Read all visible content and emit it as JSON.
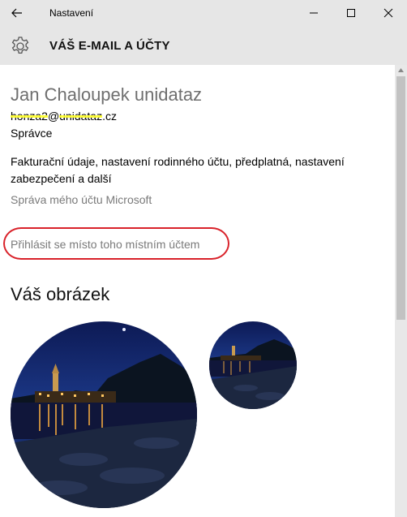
{
  "titlebar": {
    "title": "Nastavení",
    "back_icon": "back-arrow-icon",
    "minimize_icon": "minimize-icon",
    "maximize_icon": "maximize-icon",
    "close_icon": "close-icon"
  },
  "header": {
    "icon": "gear-icon",
    "title": "VÁŠ E-MAIL A ÚČTY"
  },
  "account": {
    "name": "Jan Chaloupek unidataz",
    "email_prefix": "honza2",
    "email_at": "@",
    "email_domain_hl": "unidataz",
    "email_tld": ".cz",
    "role": "Správce",
    "description": "Fakturační údaje, nastavení rodinného účtu, předplatná, nastavení zabezpečení a další",
    "manage_link": "Správa mého účtu Microsoft",
    "local_link": "Přihlásit se místo toho místním účtem"
  },
  "picture": {
    "section_title": "Váš obrázek"
  },
  "colors": {
    "chrome": "#e6e6e6",
    "annotation_red": "#d9222a",
    "highlight_yellow": "#ffff33"
  }
}
